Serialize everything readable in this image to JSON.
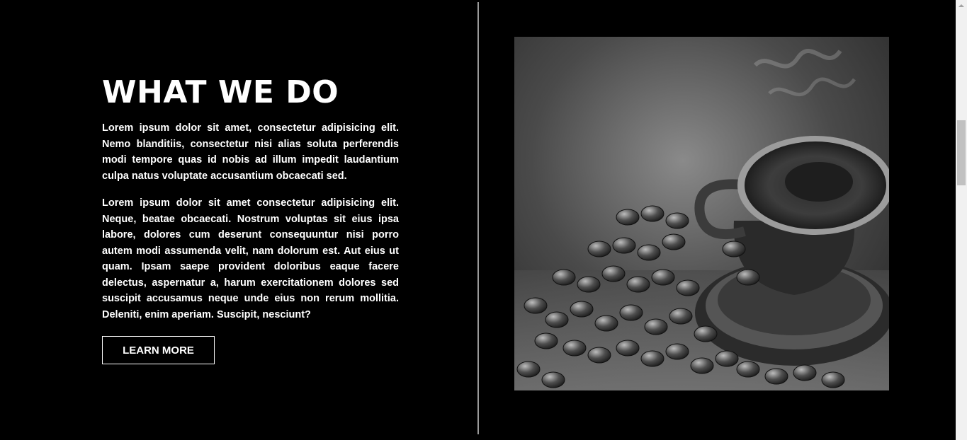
{
  "section": {
    "title": "WHAT WE DO",
    "paragraphs": [
      "Lorem ipsum dolor sit amet, consectetur adipisicing elit. Nemo blanditiis, consectetur nisi alias soluta perferendis modi tempore quas id nobis ad illum impedit laudantium culpa natus voluptate accusantium obcaecati sed.",
      "Lorem ipsum dolor sit amet consectetur adipisicing elit. Neque, beatae obcaecati. Nostrum voluptas sit eius ipsa labore, dolores cum deserunt consequuntur nisi porro autem modi assumenda velit, nam dolorum est. Aut eius ut quam. Ipsam saepe provident doloribus eaque facere delectus, aspernatur a, harum exercitationem dolores sed suscipit accusamus neque unde eius non rerum mollitia. Deleniti, enim aperiam. Suscipit, nesciunt?"
    ],
    "button_label": "LEARN MORE"
  },
  "image": {
    "subject": "coffee-cup-and-beans-photo"
  },
  "colors": {
    "background": "#000000",
    "text": "#ffffff",
    "divider": "#9a9a9a",
    "scrollbar_track": "#f1f1f1",
    "scrollbar_thumb": "#c1c1c1"
  }
}
